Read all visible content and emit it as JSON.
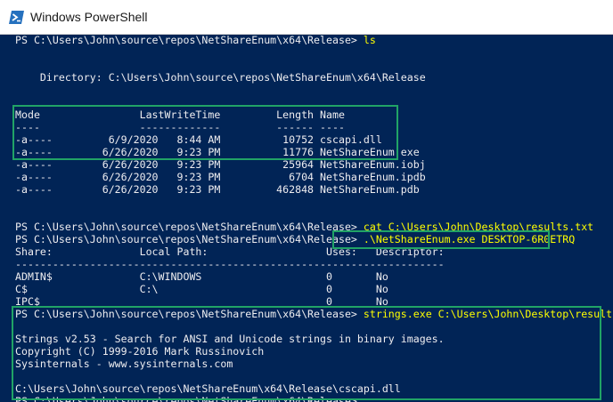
{
  "window": {
    "title": "Windows PowerShell",
    "icon": "powershell-icon",
    "colors": {
      "background": "#012456",
      "foreground": "#eeedf0",
      "command": "#ffff00",
      "highlight_box": "#21a366"
    }
  },
  "terminal": {
    "prompt": "PS C:\\Users\\John\\source\\repos\\NetShareEnum\\x64\\Release>",
    "cmd_ls": "ls",
    "directory_line": "    Directory: C:\\Users\\John\\source\\repos\\NetShareEnum\\x64\\Release",
    "dir_header": "Mode                LastWriteTime         Length Name",
    "dir_underline": "----                -------------         ------ ----",
    "dir_rows": [
      "-a----         6/9/2020   8:44 AM          10752 cscapi.dll",
      "-a----        6/26/2020   9:23 PM          11776 NetShareEnum.exe",
      "-a----        6/26/2020   9:23 PM          25964 NetShareEnum.iobj",
      "-a----        6/26/2020   9:23 PM           6704 NetShareEnum.ipdb",
      "-a----        6/26/2020   9:23 PM         462848 NetShareEnum.pdb"
    ],
    "cmd_cat": "cat C:\\Users\\John\\Desktop\\results.txt",
    "cmd_enum": ".\\NetShareEnum.exe DESKTOP-6R0ETRQ",
    "share_header": "Share:              Local Path:                   Uses:   Descriptor:",
    "share_underline": "---------------------------------------------------------------------",
    "share_rows": [
      "ADMIN$              C:\\WINDOWS                    0       No",
      "C$                  C:\\                           0       No",
      "IPC$                                              0       No"
    ],
    "cmd_strings": "strings.exe C:\\Users\\John\\Desktop\\results.txt",
    "strings_banner": "Strings v2.53 - Search for ANSI and Unicode strings in binary images.",
    "strings_copyright": "Copyright (C) 1999-2016 Mark Russinovich",
    "strings_site": "Sysinternals - www.sysinternals.com",
    "strings_result": "C:\\Users\\John\\source\\repos\\NetShareEnum\\x64\\Release\\cscapi.dll",
    "prompt_final": "PS C:\\Users\\John\\source\\repos\\NetShareEnum\\x64\\Release>"
  }
}
